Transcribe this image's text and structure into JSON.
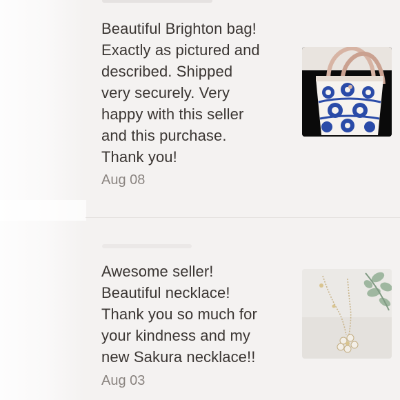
{
  "reviews": [
    {
      "text": "Beautiful Brighton bag!\nExactly as pictured and\ndescribed. Shipped\nvery securely. Very\nhappy with this seller\nand this purchase.\nThank you!",
      "date": "Aug 08",
      "photo_icon": "tote-bag-photo"
    },
    {
      "text": "Awesome seller!\nBeautiful necklace!\nThank you so much for\nyour kindness and my\nnew Sakura necklace!!",
      "date": "Aug 03",
      "photo_icon": "necklace-photo"
    }
  ],
  "colors": {
    "background": "#f4f2f1",
    "text": "#3a3532",
    "date": "#8a8480",
    "bag_blue": "#2a4ba8"
  }
}
